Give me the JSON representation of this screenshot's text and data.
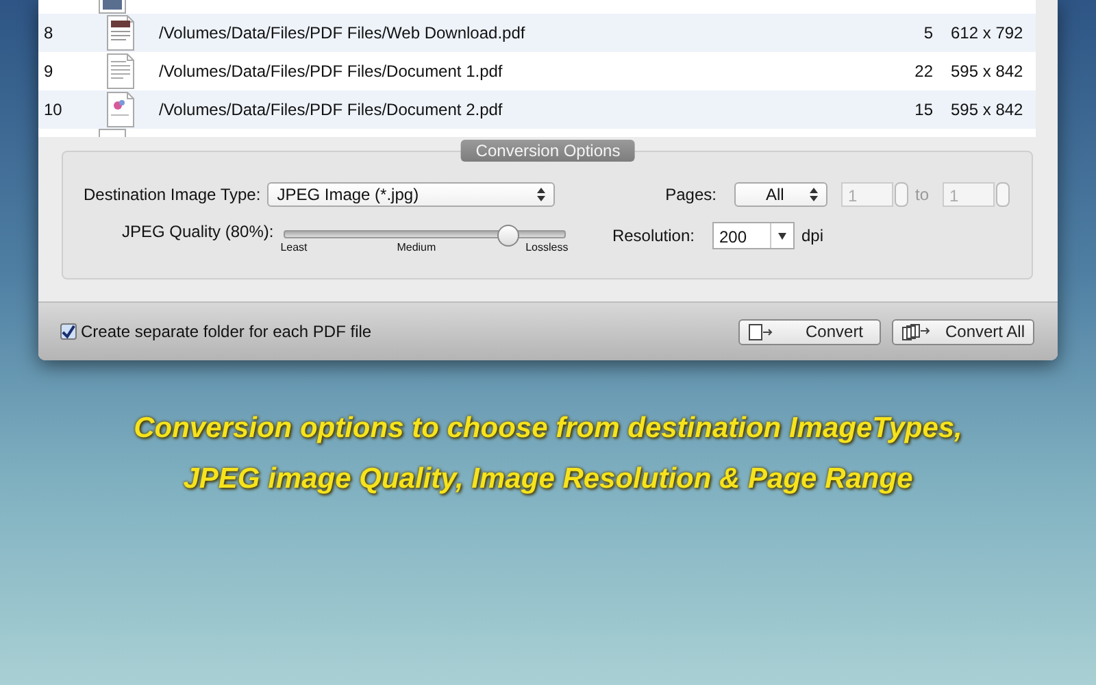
{
  "files": {
    "rows": [
      {
        "number": "8",
        "kind": "web",
        "path": "/Volumes/Data/Files/PDF Files/Web Download.pdf",
        "pages": "5",
        "size": "612 x 792",
        "selected": false
      },
      {
        "number": "9",
        "kind": "text",
        "path": "/Volumes/Data/Files/PDF Files/Document 1.pdf",
        "pages": "22",
        "size": "595 x 842",
        "selected": false
      },
      {
        "number": "10",
        "kind": "graphic",
        "path": "/Volumes/Data/Files/PDF Files/Document 2.pdf",
        "pages": "15",
        "size": "595 x 842",
        "selected": false
      }
    ]
  },
  "options": {
    "title": "Conversion Options",
    "image_type": {
      "label": "Destination Image Type:",
      "value": "JPEG Image (*.jpg)"
    },
    "quality": {
      "label": "JPEG Quality (80%):",
      "level": 0.8,
      "ticks": [
        "Least",
        "Medium",
        "Lossless"
      ]
    },
    "pages": {
      "label": "Pages:",
      "value": "All",
      "from": "1",
      "to_label": "to",
      "to": "1",
      "range_disabled": true
    },
    "resolution": {
      "label": "Resolution:",
      "value": "200",
      "unit": "dpi"
    }
  },
  "bottom_bar": {
    "separate_folder": {
      "label": "Create separate folder for each PDF file",
      "checked": true
    },
    "buttons": [
      {
        "kind": "single",
        "label": "Convert"
      },
      {
        "kind": "all",
        "label": "Convert All"
      }
    ]
  },
  "caption": [
    "Conversion options to choose from destination ImageTypes,",
    "JPEG image Quality, Image Resolution & Page Range"
  ]
}
